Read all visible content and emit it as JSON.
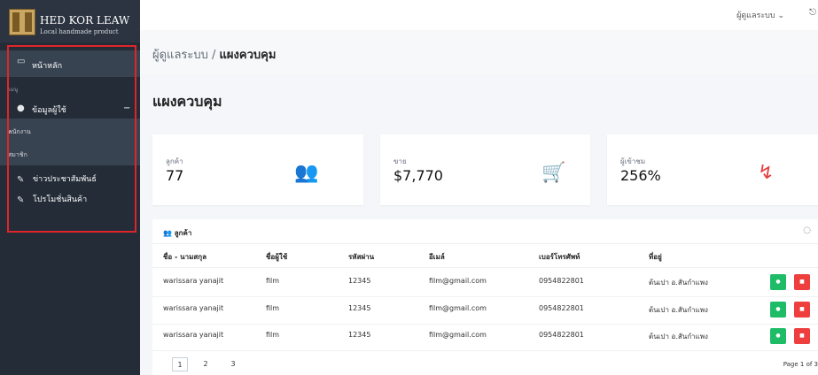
{
  "brand": {
    "title": "HED KOR LEAW",
    "subtitle": "Local handmade product"
  },
  "sidebar": {
    "home_label": "หน้าหลัก",
    "menu_caption": "เมนู",
    "user_label": "ข้อมูลผู้ใช้",
    "employee_label": "พนักงาน",
    "member_label": "สมาชิก",
    "news_label": "ข่าวประชาสัมพันธ์",
    "promo_label": "โปรโมชั่นสินค้า"
  },
  "topbar": {
    "admin_menu": "ผู้ดูแลระบบ ⌄"
  },
  "breadcrumb": {
    "parent": "ผู้ดูแลระบบ",
    "separator": "/",
    "current": "แผงควบคุม"
  },
  "page_title": "แผงควบคุม",
  "cards": [
    {
      "label": "ลูกค้า",
      "value": "77",
      "icon": "users-icon",
      "color": "#1aa861"
    },
    {
      "label": "ขาย",
      "value": "$7,770",
      "icon": "cart-icon",
      "color": "#1f8de0"
    },
    {
      "label": "ผู้เข้าชม",
      "value": "256%",
      "icon": "chart-icon",
      "color": "#e53e3e"
    }
  ],
  "table": {
    "title": "ลูกค้า",
    "columns": [
      "ชื่อ - นามสกุล",
      "ชื่อผู้ใช้",
      "รหัสผ่าน",
      "อีเมล์",
      "เบอร์โทรศัพท์",
      "ที่อยู่"
    ],
    "rows": [
      [
        "warissara yanajit",
        "film",
        "12345",
        "film@gmail.com",
        "0954822801",
        "ต้นเปา อ.สันกำแพง"
      ],
      [
        "warissara yanajit",
        "film",
        "12345",
        "film@gmail.com",
        "0954822801",
        "ต้นเปา อ.สันกำแพง"
      ],
      [
        "warissara yanajit",
        "film",
        "12345",
        "film@gmail.com",
        "0954822801",
        "ต้นเปา อ.สันกำแพง"
      ]
    ],
    "pages": [
      "1",
      "2",
      "3"
    ],
    "page_info": "Page 1 of 3"
  }
}
